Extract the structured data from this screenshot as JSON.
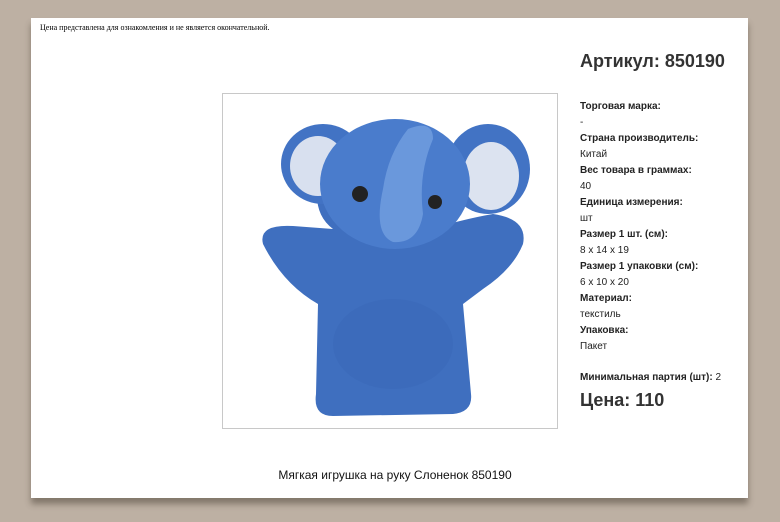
{
  "notice": "Цена представлена для ознакомления и не является окончательной.",
  "sku": "Артикул: 850190",
  "specs": [
    {
      "label": "Торговая марка:",
      "value": "-"
    },
    {
      "label": "Страна производитель:",
      "value": "Китай"
    },
    {
      "label": "Вес товара в граммах:",
      "value": "40"
    },
    {
      "label": "Единица измерения:",
      "value": "шт"
    },
    {
      "label": "Размер 1 шт. (см):",
      "value": "8 x 14 x 19"
    },
    {
      "label": "Размер 1 упаковки (см):",
      "value": "6 x 10 x 20"
    },
    {
      "label": "Материал:",
      "value": "текстиль"
    },
    {
      "label": "Упаковка:",
      "value": "Пакет"
    }
  ],
  "min_lot_label": "Минимальная партия (шт):",
  "min_lot_value": "2",
  "price": "Цена: 110",
  "product_title": "Мягкая игрушка на руку Слоненок 850190"
}
